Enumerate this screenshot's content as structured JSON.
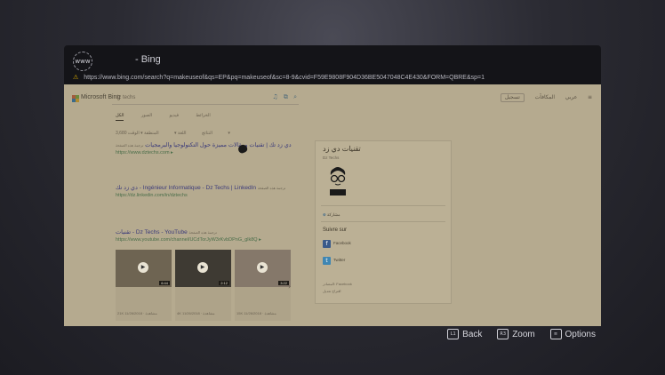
{
  "window": {
    "title": "- Bing",
    "site_icon_text": "www",
    "url": "https://www.bing.com/search?q=makeuseof&qs=EP&pq=makeuseof&sc=8-9&cvid=F59E9808F904D36BE5047048C4E430&FORM=QBRE&sp=1",
    "warning_icon": "warning-icon"
  },
  "bing": {
    "brand": "Microsoft Bing",
    "query": "dz techs",
    "search_icons": [
      "mic-icon",
      "visual-search-icon",
      "search-icon"
    ],
    "top_right": {
      "lang": "عربي",
      "rewards": "المكافآت",
      "signin": "تسجيل",
      "menu": "≡"
    },
    "tabs": [
      "الكل",
      "الصور",
      "فيديو",
      "الخرائط"
    ],
    "filters": [
      "3,680 النتائج",
      "اللغة ▾",
      "المنطقة ▾",
      "الوقت ▾"
    ],
    "results": [
      {
        "title": "دي زد تك | تقنيات ومقالات مميزة حول التكنولوجيا والبرمجيات",
        "url": "https://www.dztechs.com ▸",
        "snippet": "",
        "tag": "ترجمة هذه الصفحة"
      },
      {
        "title": "دي زد تك - Ingénieur Informatique - Dz Techs | LinkedIn",
        "url": "https://dz.linkedin.com/in/dztechs",
        "snippet": "",
        "tag": "ترجمة هذه الصفحة"
      },
      {
        "title": "تقنيات - Dz Techs - YouTube",
        "url": "https://www.youtube.com/channel/UCdTorJyW3rKvbDPnG_glk8Q ▸",
        "snippet": "",
        "tag": "ترجمة هذه الصفحة"
      }
    ],
    "videos": [
      {
        "title": "",
        "duration": "6:44",
        "meta": "21K مشاهدة · 11/26/2018"
      },
      {
        "title": "",
        "duration": "2:12",
        "meta": "4K مشاهدة · 11/26/2018"
      },
      {
        "title": "",
        "duration": "3:22",
        "meta": "15K مشاهدة · 11/26/2018"
      }
    ],
    "knowledge_panel": {
      "title": "تقنيات دي زد",
      "subtitle": "Dz Techs",
      "action": "مشاركة",
      "social_heading": "Suivre sur",
      "facebook": "Facebook",
      "twitter": "Twitter",
      "footer1": "المصادر: Facebook",
      "footer2": "اقتراح تعديل"
    },
    "colors": {
      "page_tint": "#b5aa8f",
      "link": "#3a3a7a",
      "url": "#4a6e4a"
    }
  },
  "controls": {
    "back": {
      "glyph": "L1",
      "label": "Back"
    },
    "zoom": {
      "glyph": "R3",
      "label": "Zoom"
    },
    "options": {
      "glyph": "≡",
      "label": "Options"
    }
  }
}
